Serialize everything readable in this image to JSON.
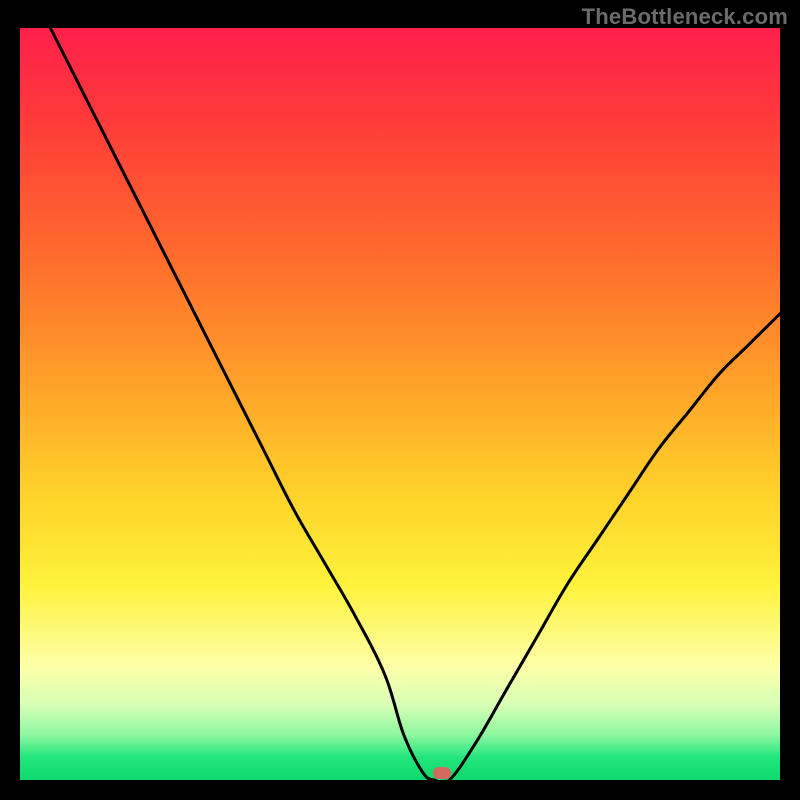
{
  "watermark": "TheBottleneck.com",
  "chart_data": {
    "type": "line",
    "title": "",
    "xlabel": "",
    "ylabel": "",
    "xlim": [
      0,
      100
    ],
    "ylim": [
      0,
      100
    ],
    "grid": false,
    "legend": false,
    "series": [
      {
        "name": "bottleneck-curve",
        "x": [
          4,
          8,
          12,
          16,
          20,
          24,
          28,
          32,
          36,
          40,
          44,
          48,
          50.5,
          53,
          54.5,
          56.5,
          60,
          64,
          68,
          72,
          76,
          80,
          84,
          88,
          92,
          96,
          100
        ],
        "values": [
          100,
          92,
          84,
          76,
          68,
          60,
          52,
          44,
          36,
          29,
          22,
          14,
          6,
          1,
          0,
          0,
          5,
          12,
          19,
          26,
          32,
          38,
          44,
          49,
          54,
          58,
          62
        ]
      }
    ],
    "marker": {
      "x": 55.5,
      "y": 0.9
    },
    "gradient_stops": [
      {
        "pos": 0,
        "color": "#ff1f4b"
      },
      {
        "pos": 12,
        "color": "#ff3a3a"
      },
      {
        "pos": 30,
        "color": "#ff6a2d"
      },
      {
        "pos": 48,
        "color": "#ffa329"
      },
      {
        "pos": 62,
        "color": "#ffd22a"
      },
      {
        "pos": 74,
        "color": "#fff23b"
      },
      {
        "pos": 85,
        "color": "#fdffa8"
      },
      {
        "pos": 90,
        "color": "#d7ffb5"
      },
      {
        "pos": 94,
        "color": "#8cf7a0"
      },
      {
        "pos": 97,
        "color": "#22e67c"
      },
      {
        "pos": 100,
        "color": "#0fd86d"
      }
    ],
    "colors": {
      "curve": "#000000",
      "marker": "#d46a5f",
      "frame": "#000000"
    }
  }
}
